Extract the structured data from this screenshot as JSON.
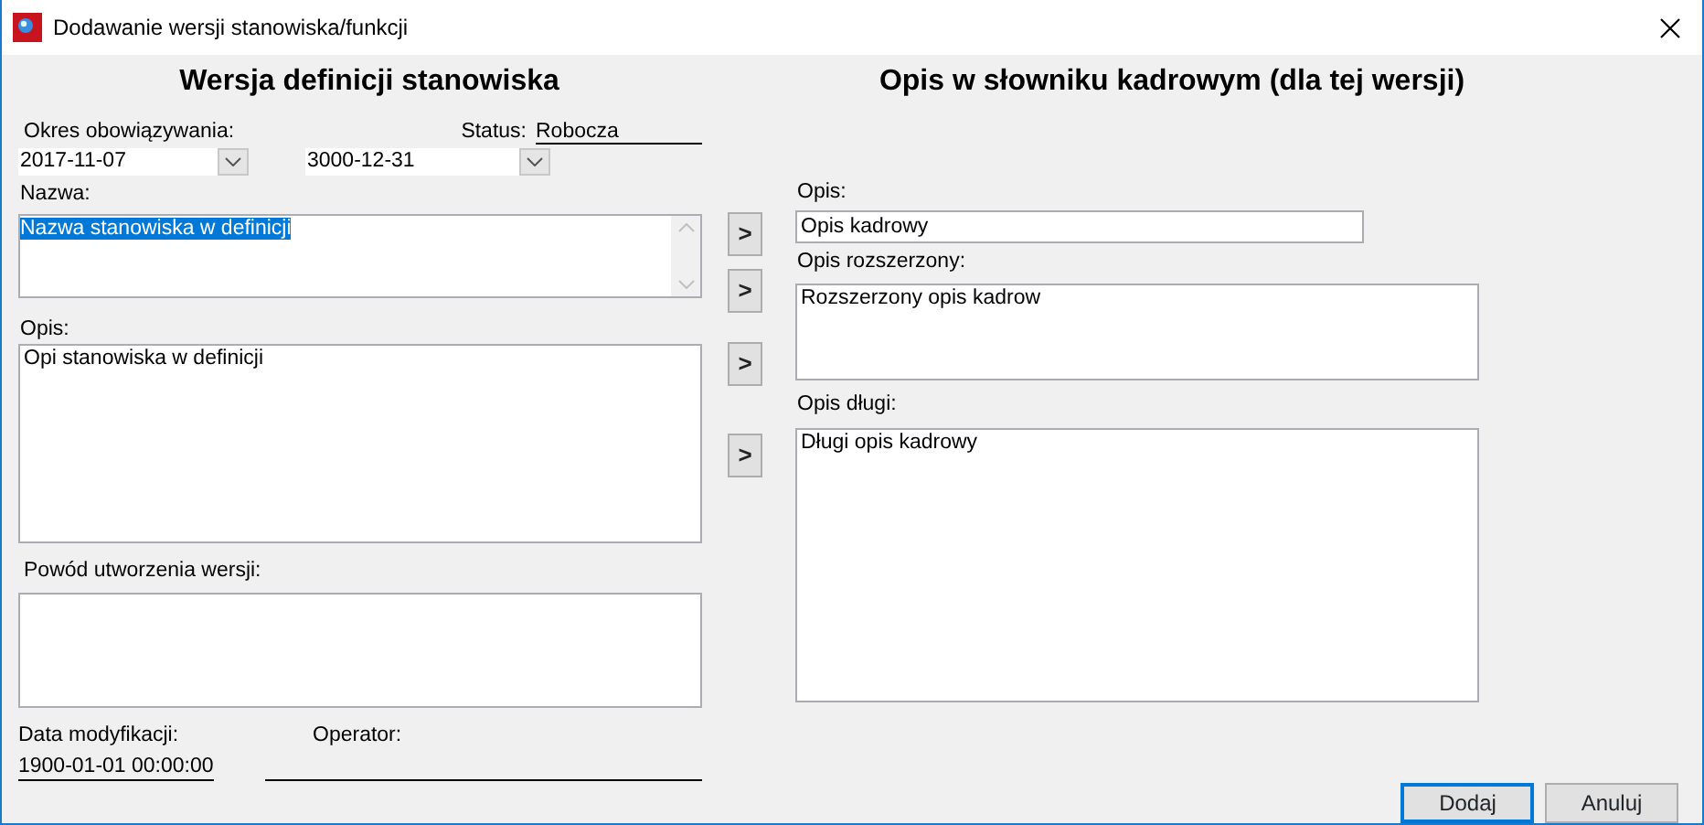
{
  "window": {
    "title": "Dodawanie wersji stanowiska/funkcji"
  },
  "left": {
    "heading": "Wersja definicji stanowiska",
    "period_label": "Okres obowiązywania:",
    "date_from": "2017-11-07",
    "date_to": "3000-12-31",
    "status_label": "Status:",
    "status_value": "Robocza",
    "name_label": "Nazwa:",
    "name_value": "Nazwa stanowiska w definicji",
    "name_text_selected": true,
    "desc_label": "Opis:",
    "desc_value": "Opi stanowiska w definicji",
    "reason_label": "Powód utworzenia wersji:",
    "modified_label": "Data modyfikacji:",
    "modified_value": "1900-01-01 00:00:00",
    "operator_label": "Operator:"
  },
  "copy_buttons": [
    ">",
    ">",
    ">",
    ">"
  ],
  "right": {
    "heading": "Opis w słowniku kadrowym (dla tej wersji)",
    "desc_label": "Opis:",
    "desc_value": "Opis kadrowy",
    "ext_label": "Opis rozszerzony:",
    "ext_value": "Rozszerzony opis kadrow",
    "long_label": "Opis długi:",
    "long_value": "Długi opis kadrowy"
  },
  "buttons": [
    {
      "label": "Dodaj",
      "default": true
    },
    {
      "label": "Anuluj",
      "default": false
    }
  ]
}
